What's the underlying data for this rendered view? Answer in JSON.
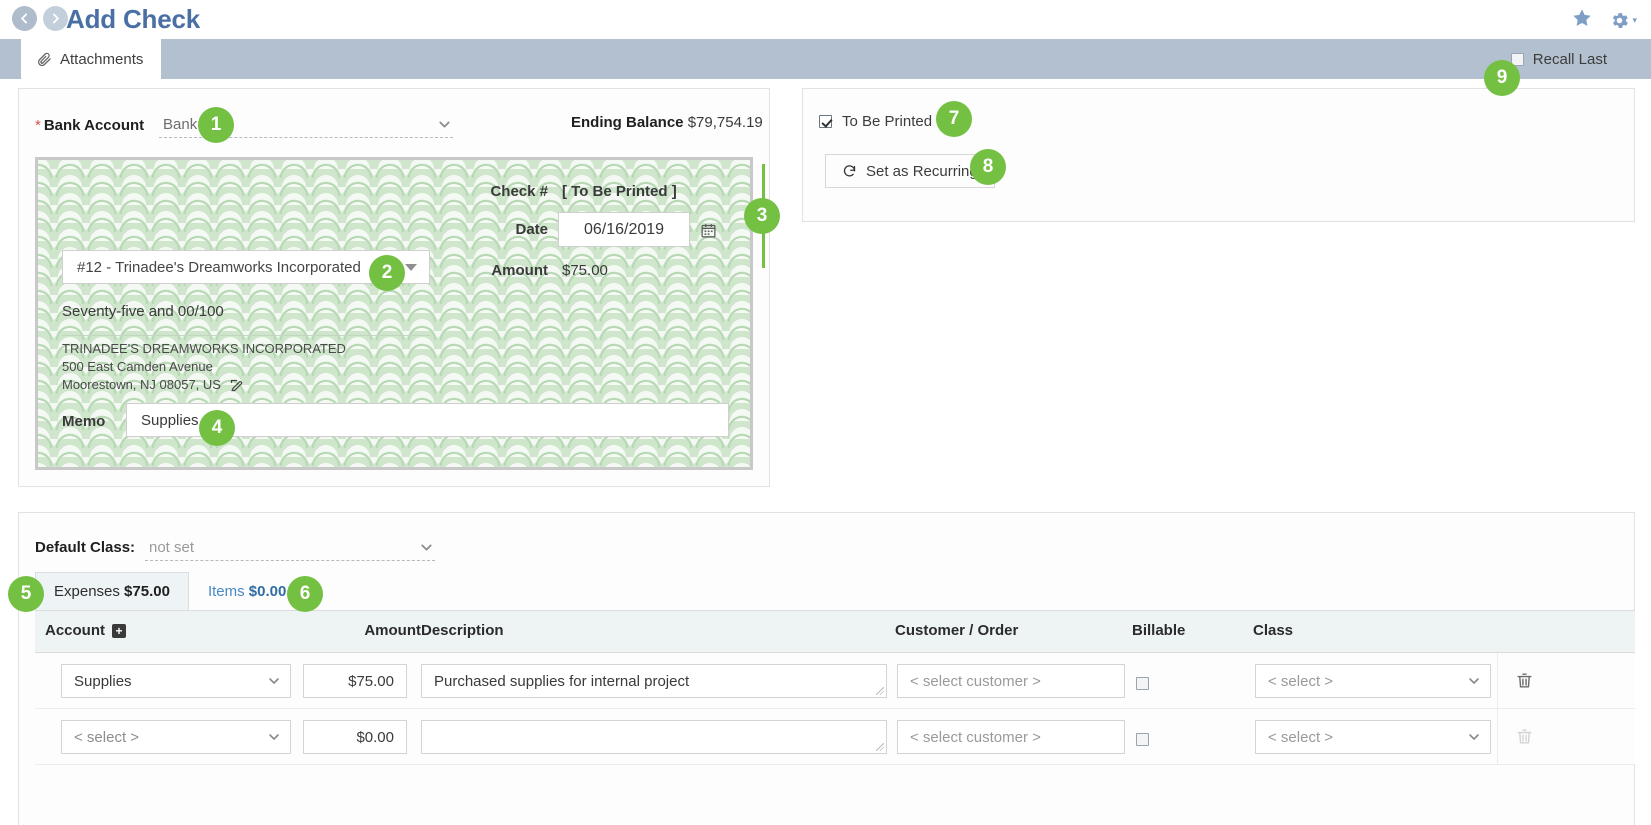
{
  "titlebar": {
    "title": "Add Check",
    "back_icon": "back-arrow-icon",
    "forward_icon": "forward-arrow-icon",
    "star_icon": "star-icon",
    "gear_icon": "gear-icon"
  },
  "toolbar": {
    "attachments_label": "Attachments",
    "attachments_icon": "paperclip-icon",
    "recall_last_label": "Recall Last",
    "recall_last_checked": false
  },
  "bank": {
    "label": "Bank Account",
    "required_mark": "*",
    "value": "Bank",
    "ending_balance_label": "Ending Balance",
    "ending_balance_value": "$79,754.19"
  },
  "check": {
    "check_number_label": "Check #",
    "check_number_value": "[ To Be Printed ]",
    "date_label": "Date",
    "date_value": "06/16/2019",
    "calendar_icon": "calendar-icon",
    "amount_label": "Amount",
    "amount_value": "$75.00",
    "payee_value": "#12 - Trinadee's Dreamworks Incorporated",
    "amount_words": "Seventy-five and 00/100",
    "address": [
      "TRINADEE'S DREAMWORKS INCORPORATED",
      "500 East Camden Avenue",
      "Moorestown, NJ 08057, US"
    ],
    "edit_address_icon": "edit-icon",
    "memo_label": "Memo",
    "memo_value": "Supplies"
  },
  "options": {
    "to_be_printed_label": "To Be Printed",
    "to_be_printed_checked": true,
    "set_as_recurring_label": "Set as Recurring",
    "recurring_icon": "refresh-icon"
  },
  "default_class": {
    "label": "Default Class:",
    "value": "not set"
  },
  "tabs": [
    {
      "label": "Expenses",
      "amount": "$75.00",
      "active": true
    },
    {
      "label": "Items",
      "amount": "$0.00",
      "active": false
    }
  ],
  "table": {
    "columns": {
      "account": "Account",
      "add_account_icon": "plus-icon",
      "amount": "Amount",
      "description": "Description",
      "customer_order": "Customer / Order",
      "billable": "Billable",
      "class": "Class"
    },
    "rows": [
      {
        "account": "Supplies",
        "amount": "$75.00",
        "description": "Purchased supplies for internal project",
        "customer": "< select customer >",
        "billable": false,
        "class": "< select >",
        "delete_icon": "trash-icon",
        "delete_enabled": true
      },
      {
        "account": "< select >",
        "amount": "$0.00",
        "description": "",
        "customer": "< select customer >",
        "billable": false,
        "class": "< select >",
        "delete_icon": "trash-icon",
        "delete_enabled": false
      }
    ]
  },
  "callouts": [
    {
      "n": "1"
    },
    {
      "n": "2"
    },
    {
      "n": "3"
    },
    {
      "n": "4"
    },
    {
      "n": "5"
    },
    {
      "n": "6"
    },
    {
      "n": "7"
    },
    {
      "n": "8"
    },
    {
      "n": "9"
    }
  ],
  "colors": {
    "accent_green": "#74c043",
    "title_blue": "#4a6fa5",
    "toolbar_gray": "#b3c0cf",
    "link_blue": "#4a89c4"
  }
}
